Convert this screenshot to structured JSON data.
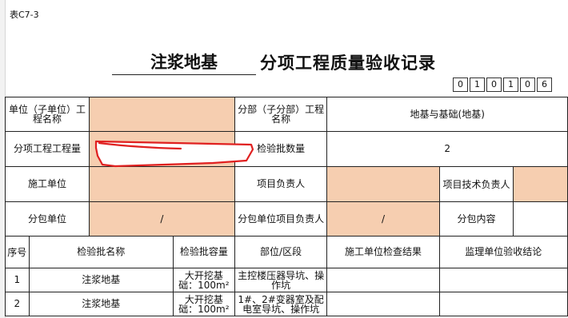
{
  "doc_code": "表C7-3",
  "title": {
    "blank_value": "注浆地基",
    "main": "分项工程质量验收记录"
  },
  "form_code_digits": [
    "0",
    "1",
    "0",
    "1",
    "0",
    "6"
  ],
  "header": {
    "unit_label": "单位（子单位）工程名称",
    "unit_value": "",
    "division_label": "分部（子分部）工程名称",
    "division_value": "地基与基础(地基)",
    "item_qty_label": "分项工程工程量",
    "item_qty_value": "",
    "batch_count_label": "检验批数量",
    "batch_count_value": "2",
    "contractor_label": "施工单位",
    "contractor_value": "",
    "pm_label": "项目负责人",
    "pm_value": "",
    "tech_lead_label": "项目技术负责人",
    "tech_lead_value": "",
    "sub_label": "分包单位",
    "sub_value": "/",
    "sub_pm_label": "分包单位项目负责人",
    "sub_pm_value": "/",
    "sub_content_label": "分包内容",
    "sub_content_value": ""
  },
  "columns": [
    "序号",
    "检验批名称",
    "检验批容量",
    "部位/区段",
    "施工单位检查结果",
    "监理单位验收结论"
  ],
  "rows": [
    {
      "no": "1",
      "name": "注浆地基",
      "capacity": "大开挖基础：100m²",
      "location": "主控楼压器导坑、操作坑",
      "check": "",
      "conclusion": ""
    },
    {
      "no": "2",
      "name": "注浆地基",
      "capacity": "大开挖基础：100m²",
      "location": "1#、2#变器室及配电室导坑、操作坑",
      "check": "",
      "conclusion": ""
    }
  ],
  "colors": {
    "highlight": "#f6ceb0",
    "annotation": "#e02020"
  }
}
